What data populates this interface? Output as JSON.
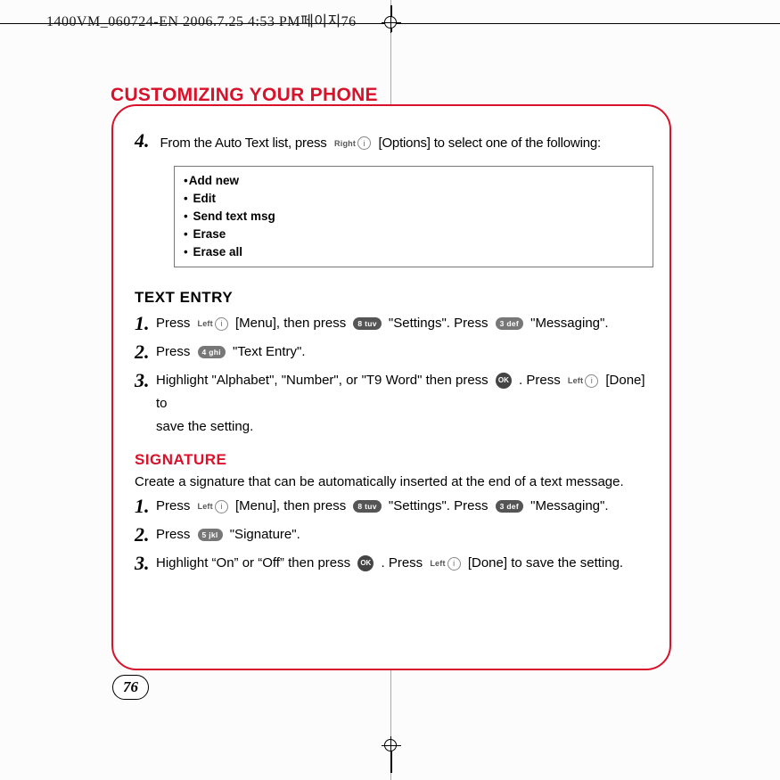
{
  "slug": "1400VM_060724-EN  2006.7.25 4:53 PM페이지76",
  "title": "CUSTOMIZING YOUR PHONE",
  "intro_step": {
    "num": "4.",
    "pre": "From the Auto Text list, press",
    "soft": "Right",
    "post": "[Options] to select one of the following:"
  },
  "options": [
    "Add new",
    "Edit",
    "Send text msg",
    "Erase",
    "Erase all"
  ],
  "sec1": {
    "head": "TEXT ENTRY"
  },
  "s1": {
    "num": "1.",
    "a": "Press",
    "soft": "Left",
    "b": "[Menu], then press",
    "k1": "8 tuv",
    "c": "\"Settings\".  Press",
    "k2": "3 def",
    "d": "\"Messaging\"."
  },
  "s2": {
    "num": "2.",
    "a": "Press",
    "k": "4 ghi",
    "b": "\"Text Entry\"."
  },
  "s3": {
    "num": "3.",
    "a": "Highlight \"Alphabet\", \"Number\", or \"T9 Word\" then press",
    "ok": "OK",
    "b": ".  Press",
    "soft": "Left",
    "c": "[Done] to",
    "d": "save the setting."
  },
  "sec2": {
    "head": "SIGNATURE",
    "desc": "Create a signature that can be automatically inserted at the end of a text message."
  },
  "t1": {
    "num": "1.",
    "a": "Press",
    "soft": "Left",
    "b": "[Menu], then press",
    "k1": "8 tuv",
    "c": "\"Settings\".  Press",
    "k2": "3 def",
    "d": "\"Messaging\"."
  },
  "t2": {
    "num": "2.",
    "a": "Press",
    "k": "5 jkl",
    "b": "\"Signature\"."
  },
  "t3": {
    "num": "3.",
    "a": "Highlight “On” or “Off” then press",
    "ok": "OK",
    "b": ".  Press",
    "soft": "Left",
    "c": "[Done] to save the setting."
  },
  "page": "76"
}
